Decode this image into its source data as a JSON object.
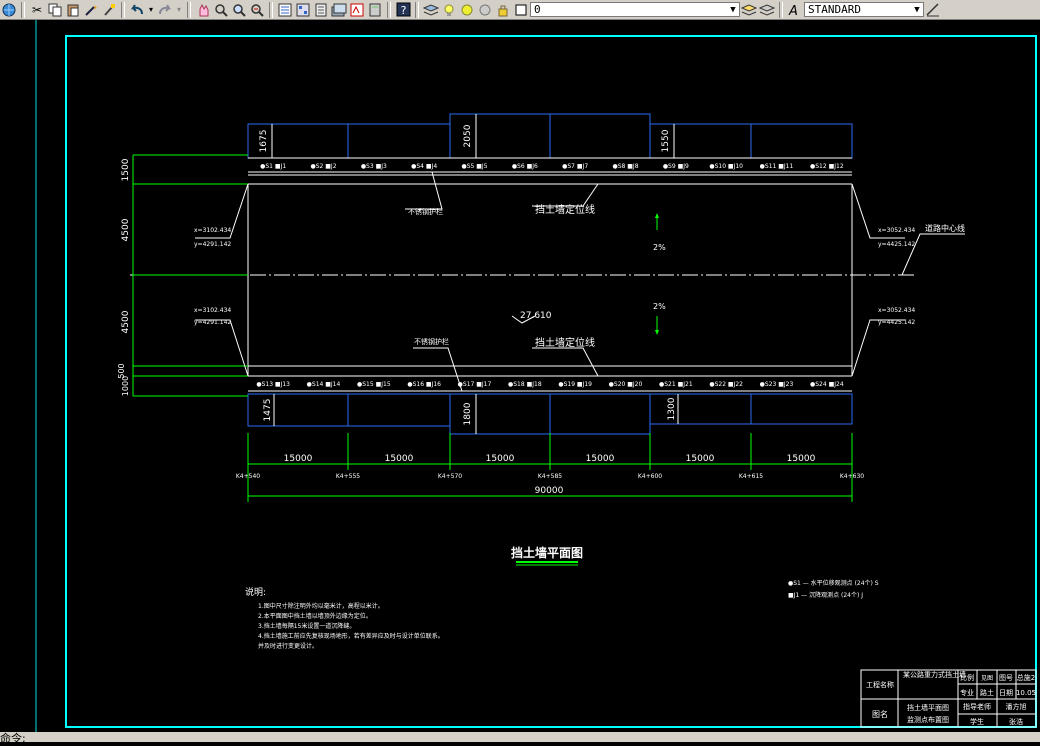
{
  "toolbar": {
    "layer_value": "0",
    "textstyle_value": "STANDARD",
    "icons": [
      "globe-icon",
      "cut-icon",
      "copy-icon",
      "paste-icon",
      "match-properties-icon",
      "brush-icon",
      "undo-icon",
      "redo-icon",
      "pan-icon",
      "zoom-realtime-icon",
      "zoom-window-icon",
      "zoom-previous-icon",
      "properties-icon",
      "design-center-icon",
      "tool-palettes-icon",
      "sheet-set-icon",
      "markup-icon",
      "calculator-icon",
      "help-icon",
      "layer-manager-icon",
      "layer-on-icon",
      "layer-freeze-icon",
      "layer-lock-icon",
      "layer-color-icon",
      "text-style-icon"
    ]
  },
  "drawing": {
    "title": "挡土墙平面图",
    "station_top_labels": [
      "●S1 ■J1",
      "●S2 ■J2",
      "●S3 ■J3",
      "●S4 ■J4",
      "●S5 ■J5",
      "●S6 ■J6",
      "●S7 ■J7",
      "●S8 ■J8",
      "●S9 ■J9",
      "●S10 ■J10",
      "●S11 ■J11",
      "●S12 ■J12"
    ],
    "station_bottom_labels": [
      "●S13 ■J13",
      "●S14 ■J14",
      "●S15 ■J15",
      "●S16 ■J16",
      "●S17 ■J17",
      "●S18 ■J18",
      "●S19 ■J19",
      "●S20 ■J20",
      "●S21 ■J21",
      "●S22 ■J22",
      "●S23 ■J23",
      "●S24 ■J24"
    ],
    "top_heights": [
      "1675",
      "2050",
      "1550"
    ],
    "bottom_heights": [
      "1475",
      "1800",
      "1300"
    ],
    "left_dims": [
      "1500",
      "4500",
      "4500",
      "500",
      "1000"
    ],
    "span_labels": [
      "15000",
      "15000",
      "15000",
      "15000",
      "15000",
      "15000"
    ],
    "total_label": "90000",
    "chainages": [
      "K4+540",
      "K4+555",
      "K4+570",
      "K4+585",
      "K4+600",
      "K4+615",
      "K4+630"
    ],
    "annotations": {
      "joint_top": "不锈钢护栏",
      "joint_bottom": "不锈钢护栏",
      "wall_line_top": "挡土墙定位线",
      "wall_line_bottom": "挡土墙定位线",
      "centerline": "道路中心线",
      "slope_top": "2%",
      "slope_bottom": "2%",
      "elevation": "27.610"
    },
    "coords": {
      "left_top": [
        "x=3102.434",
        "y=4291.142"
      ],
      "left_bottom": [
        "x=3102.434",
        "y=4291.142"
      ],
      "right_top": [
        "x=3052.434",
        "y=4425.142"
      ],
      "right_bottom": [
        "x=3052.434",
        "y=4425.142"
      ]
    },
    "notes_title": "说明:",
    "notes": [
      "1.图中尺寸除注明外均以毫米计，高程以米计。",
      "2.本平面图中挡土墙以墙顶外边缘为定位。",
      "3.挡土墙每隔15米设置一道沉降缝。",
      "4.挡土墙施工前应先复核现场地形，若有差异应及时与设计单位联系。",
      "  并及时进行变更设计。"
    ],
    "legend": [
      "●S1 — 水平位移观测点 (24个) S",
      "■J1 — 沉降观测点 (24个) J"
    ],
    "title_block": {
      "project_label": "工程名称",
      "project_name": "某公路重力式挡土墙",
      "scale_label": "比例",
      "scale_value": "见图",
      "sheet_label": "图号",
      "sheet_value": "总施2",
      "major_label": "专业",
      "major_value": "路土",
      "date_label": "日期",
      "date_value": "10.05",
      "drawing_label": "图名",
      "drawing_name_1": "挡土墙平面图",
      "drawing_name_2": "监测点布置图",
      "advisor_label": "指导老师",
      "advisor_value": "潘方旭",
      "student_label": "学生",
      "student_value": "张浩"
    }
  },
  "status": {
    "text": "命令:"
  }
}
